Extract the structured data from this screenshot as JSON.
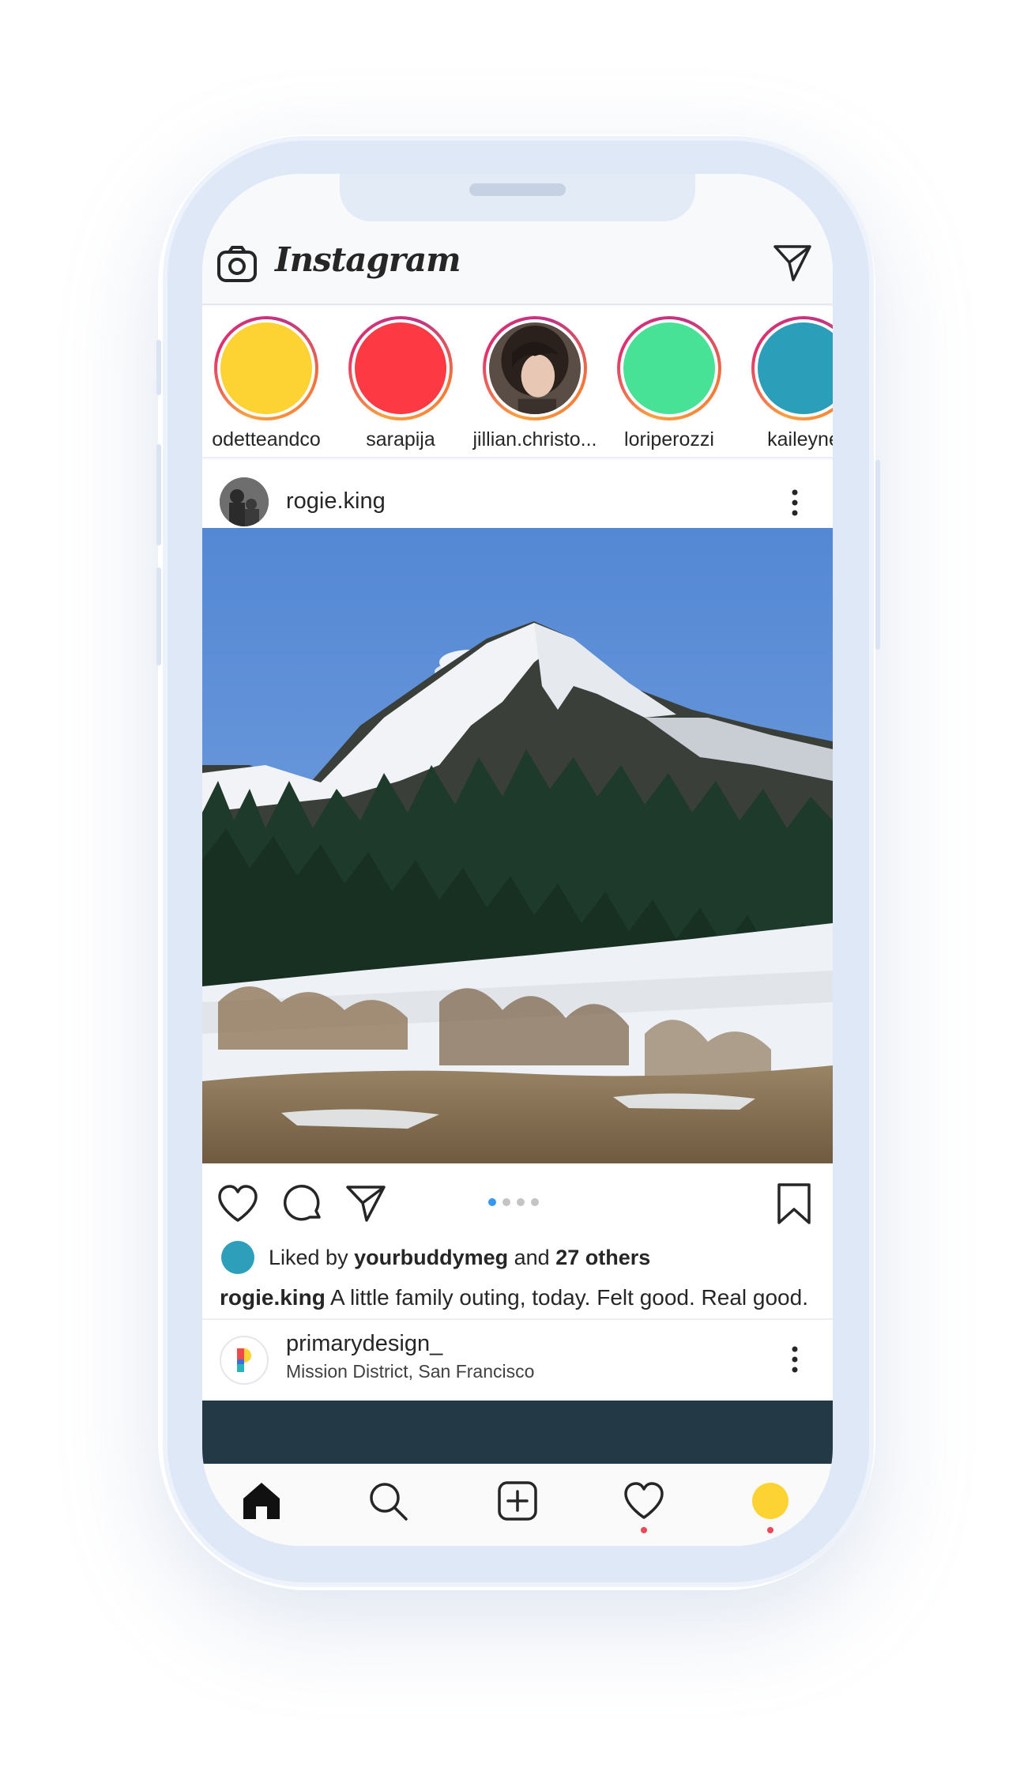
{
  "app": {
    "logo_text": "Instagram"
  },
  "stories": [
    {
      "username": "odetteandco",
      "color": "#fdd334"
    },
    {
      "username": "sarapija",
      "color": "#fd3a44"
    },
    {
      "username": "jillian.christo...",
      "color": "photo"
    },
    {
      "username": "loriperozzi",
      "color": "#48e296"
    },
    {
      "username": "kaileyne",
      "color": "#2b9eba"
    }
  ],
  "post": {
    "username": "rogie.king",
    "carousel": {
      "count": 4,
      "active": 1
    },
    "likes": {
      "prefix": "Liked by",
      "liker": "yourbuddymeg",
      "joiner": "and",
      "others": "27 others",
      "liker_color": "#2d9fba"
    },
    "caption": {
      "username": "rogie.king",
      "text": "A little family outing, today. Felt good. Real good."
    }
  },
  "next_post": {
    "username": "primarydesign_",
    "location": "Mission District, San Francisco"
  },
  "tabbar": {
    "items": [
      "home",
      "search",
      "new-post",
      "activity",
      "profile"
    ],
    "activity_badge": true,
    "profile_badge": true,
    "profile_color": "#fdd334",
    "badge_color": "#ed4956"
  }
}
